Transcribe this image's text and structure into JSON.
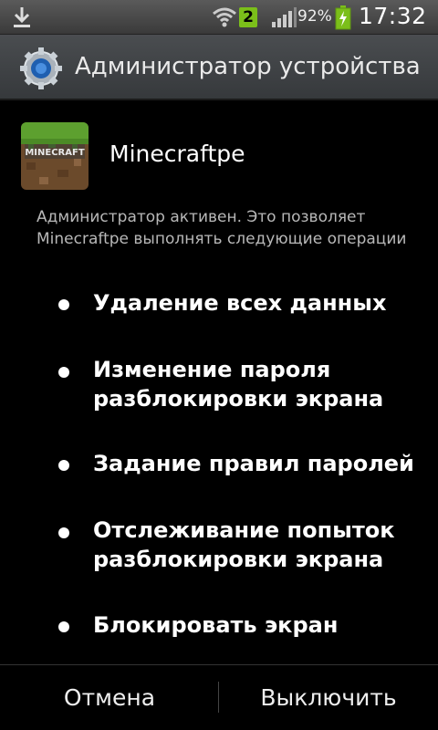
{
  "status_bar": {
    "icons": [
      "download-icon",
      "wifi-icon",
      "notification-badge",
      "signal-icon",
      "battery-icon"
    ],
    "notification_count": "2",
    "battery_percent": "92%",
    "battery_level": 0.92,
    "time": "17:32",
    "badge_color": "#7bbf1a"
  },
  "title_bar": {
    "icon": "gear-icon",
    "title": "Администратор устройства"
  },
  "app": {
    "icon": "minecraft-app-icon",
    "logo_text": "MINECRAFT",
    "name": "Minecraftpe"
  },
  "description": "Администратор активен. Это позволяет Minecraftpe выполнять следующие операции",
  "permissions": [
    {
      "line1": "Удаление всех данных",
      "line2": ""
    },
    {
      "line1": "Изменение пароля",
      "line2": "разблокировки экрана"
    },
    {
      "line1": "Задание правил паролей",
      "line2": ""
    },
    {
      "line1": "Отслеживание попыток",
      "line2": "разблокировки экрана"
    },
    {
      "line1": "Блокировать экран",
      "line2": ""
    }
  ],
  "buttons": {
    "cancel": "Отмена",
    "deactivate": "Выключить"
  }
}
